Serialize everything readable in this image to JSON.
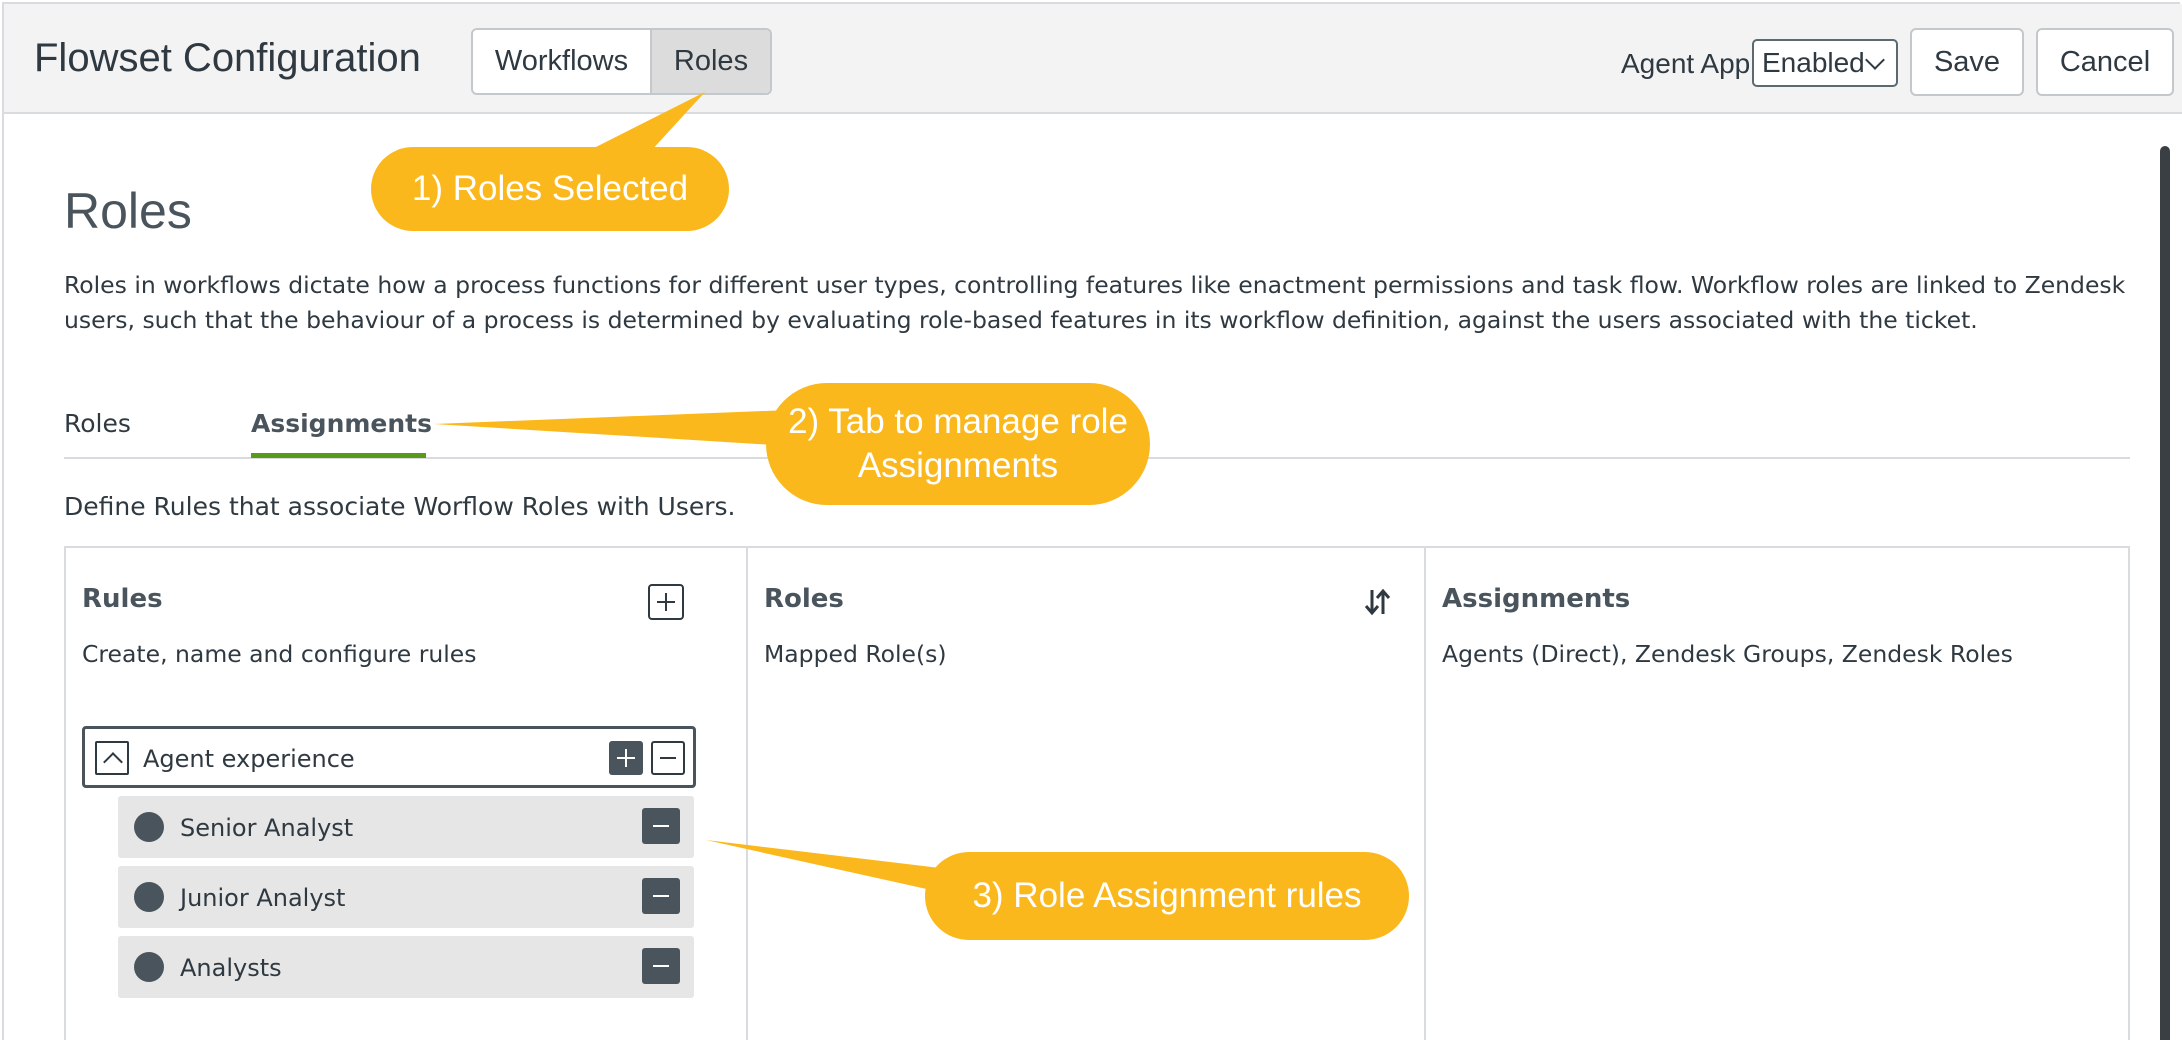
{
  "header": {
    "title": "Flowset Configuration",
    "segments": {
      "workflows": "Workflows",
      "roles": "Roles",
      "selected": "Roles"
    },
    "agent_app_label": "Agent App",
    "agent_app_value": "Enabled",
    "save_label": "Save",
    "cancel_label": "Cancel"
  },
  "main": {
    "title": "Roles",
    "description": "Roles in workflows dictate how a process functions for different user types, controlling features like enactment permissions and task flow. Workflow roles are linked to Zendesk users, such that the behaviour of a process is determined by evaluating role-based features in its workflow definition, against the users associated with the ticket.",
    "tabs": {
      "roles": "Roles",
      "assignments": "Assignments",
      "active": "Assignments"
    },
    "subdescription": "Define Rules that associate Worflow Roles with Users."
  },
  "columns": {
    "rules": {
      "title": "Rules",
      "subtitle": "Create, name and configure rules"
    },
    "roles": {
      "title": "Roles",
      "subtitle": "Mapped Role(s)"
    },
    "assignments": {
      "title": "Assignments",
      "subtitle": "Agents (Direct), Zendesk Groups, Zendesk Roles"
    }
  },
  "rule_group": {
    "name": "Agent experience",
    "roles": [
      {
        "label": "Senior Analyst"
      },
      {
        "label": "Junior Analyst"
      },
      {
        "label": "Analysts"
      }
    ]
  },
  "callouts": {
    "roles_selected": "1) Roles Selected",
    "tab_manage": "2) Tab to manage role Assignments",
    "role_rules": "3) Role Assignment rules"
  },
  "colors": {
    "callout": "#fbb81c",
    "tab_active_underline": "#5a9a1a",
    "dark": "#49545c"
  },
  "icons": [
    "plus-icon",
    "sort-icon",
    "chevron-up-icon",
    "minus-icon",
    "chevron-down-icon"
  ]
}
